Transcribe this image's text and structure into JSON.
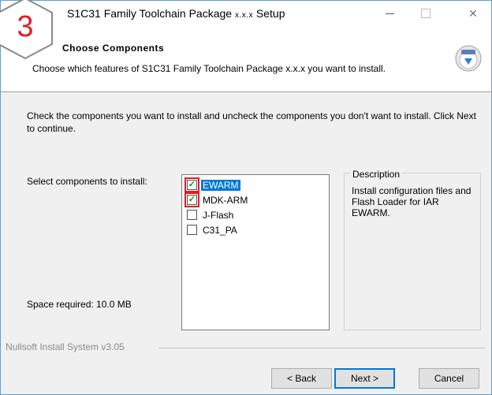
{
  "window": {
    "title": "S1C31 Family Toolchain Package",
    "title_version": "x.x.x",
    "title_suffix": "Setup",
    "close_glyph": "✕"
  },
  "header": {
    "title": "Choose Components",
    "subtitle": "Choose which features of S1C31 Family Toolchain Package x.x.x you want to install."
  },
  "content": {
    "intro": "Check the components you want to install and uncheck the components you don't want to install. Click Next to continue.",
    "select_label": "Select components to install:",
    "space_required": "Space required: 10.0 MB",
    "components": [
      {
        "label": "EWARM",
        "checked": true,
        "selected": true,
        "highlighted": true
      },
      {
        "label": "MDK-ARM",
        "checked": true,
        "selected": false,
        "highlighted": true
      },
      {
        "label": "J-Flash",
        "checked": false,
        "selected": false,
        "highlighted": false
      },
      {
        "label": "C31_PA",
        "checked": false,
        "selected": false,
        "highlighted": false
      }
    ],
    "description": {
      "title": "Description",
      "text": "Install configuration files and Flash Loader for IAR EWARM."
    }
  },
  "footer": {
    "branding": "Nullsoft Install System v3.05",
    "back_label": "< Back",
    "next_label": "Next >",
    "cancel_label": "Cancel"
  },
  "annotation": {
    "step_number": "3",
    "color": "#e01e25"
  },
  "colors": {
    "selection": "#0078d7",
    "check": "#1f8f1f",
    "highlight_box": "#e01e25"
  }
}
